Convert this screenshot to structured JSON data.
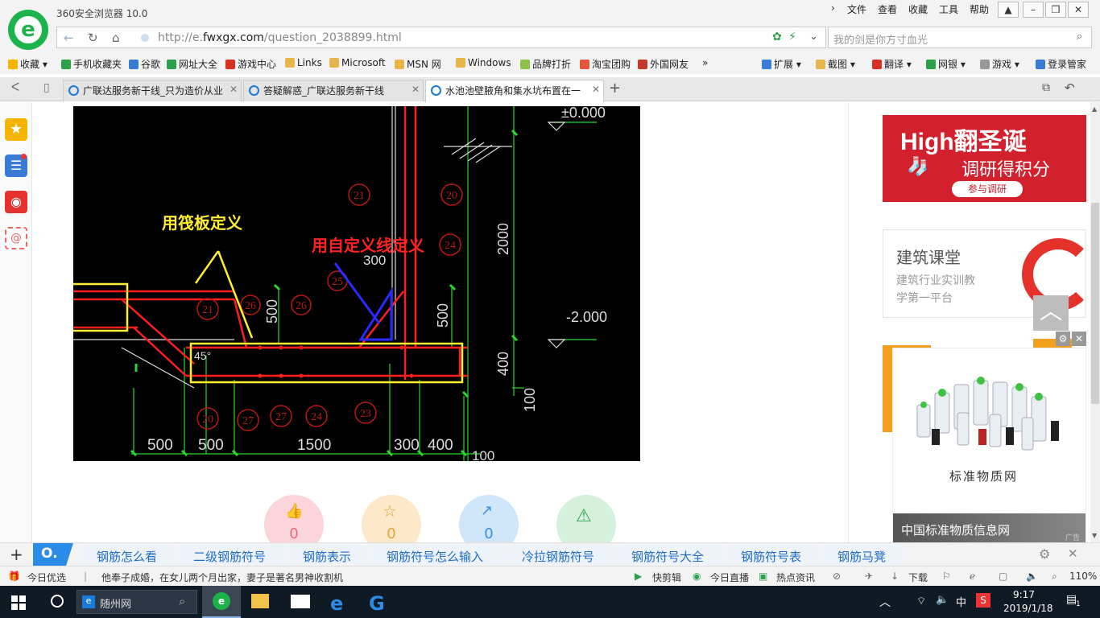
{
  "browser": {
    "app_title": "360安全浏览器 10.0",
    "menus": [
      "文件",
      "查看",
      "收藏",
      "工具",
      "帮助"
    ],
    "url_prefix": "http://e.",
    "url_domain": "fwxgx.com",
    "url_path": "/question_2038899.html",
    "search_placeholder": "我的剑是你方寸血光"
  },
  "bookmarks": {
    "left": [
      {
        "label": "收藏",
        "color": "#f5b400"
      },
      {
        "label": "手机收藏夹",
        "color": "#2aa14a"
      },
      {
        "label": "谷歌",
        "color": "#3a7bd5"
      },
      {
        "label": "网址大全",
        "color": "#2aa14a"
      },
      {
        "label": "游戏中心",
        "color": "#d93025"
      },
      {
        "label": "Links",
        "color": "#e8b54a"
      },
      {
        "label": "Microsoft",
        "color": "#e8b54a"
      },
      {
        "label": "MSN 网",
        "color": "#e8b54a"
      },
      {
        "label": "Windows",
        "color": "#e8b54a"
      },
      {
        "label": "品牌打折",
        "color": "#8bc34a"
      },
      {
        "label": "淘宝团购",
        "color": "#e8553a"
      },
      {
        "label": "外国网友",
        "color": "#c0392b"
      }
    ],
    "right": [
      {
        "label": "扩展",
        "color": "#3a7bd5"
      },
      {
        "label": "截图",
        "color": "#e8b54a"
      },
      {
        "label": "翻译",
        "color": "#d93025"
      },
      {
        "label": "网银",
        "color": "#2aa14a"
      },
      {
        "label": "游戏",
        "color": "#999999"
      },
      {
        "label": "登录管家",
        "color": "#3a7bd5"
      }
    ]
  },
  "tabs": [
    {
      "label": "广联达服务新干线_只为造价从业"
    },
    {
      "label": "答疑解惑_广联达服务新干线"
    },
    {
      "label": "水池池壁腋角和集水坑布置在一"
    }
  ],
  "cad": {
    "label_raft": "用筏板定义",
    "label_custom": "用自定义线定义",
    "elev_top": "±0.000",
    "elev_mid": "-2.000",
    "dim_2000": "2000",
    "dim_300_top": "300",
    "dim_500_a": "500",
    "dim_500_b": "500",
    "dim_400": "400",
    "dim_100_v": "100",
    "dim_100_h": "100",
    "angle": "45°",
    "bottom_dims": [
      "500",
      "500",
      "1500",
      "300",
      "400"
    ],
    "circles": [
      "21",
      "20",
      "24",
      "25",
      "21",
      "26",
      "26",
      "20",
      "27",
      "27",
      "24",
      "23"
    ]
  },
  "actions": [
    {
      "icon": "thumbs-up",
      "count": "0",
      "color": "#fbd5da",
      "fg": "#e66a7c"
    },
    {
      "icon": "star",
      "count": "0",
      "color": "#fde9c9",
      "fg": "#e6a23c"
    },
    {
      "icon": "share",
      "count": "0",
      "color": "#cfe6fb",
      "fg": "#3a8ee6"
    },
    {
      "icon": "warning",
      "count": "",
      "color": "#d5f1dc",
      "fg": "#2ea44f"
    }
  ],
  "ads": {
    "ad1_main": "High翻圣诞",
    "ad1_sub": "调研得积分",
    "ad1_btn": "参与调研",
    "ad2_title": "建筑课堂",
    "ad2_line1": "建筑行业实训教",
    "ad2_line2": "学第一平台",
    "ad3_caption": "标准物质网",
    "ad3_title": "中国标准物质信息网",
    "ad3_tag": "广告"
  },
  "hot_searches": [
    "钢筋怎么看",
    "二级钢筋符号",
    "钢筋表示",
    "钢筋符号怎么输入",
    "冷拉钢筋符号",
    "钢筋符号大全",
    "钢筋符号表",
    "钢筋马凳"
  ],
  "status": {
    "today": "今日优选",
    "news": "他奉子成婚，在女儿两个月出家，妻子是著名男神收割机",
    "items": [
      "快剪辑",
      "今日直播",
      "热点资讯",
      "下载"
    ],
    "zoom": "110%"
  },
  "taskbar": {
    "search_text": "随州网",
    "ime": "中",
    "time": "9:17",
    "date": "2019/1/18",
    "notif": "1"
  }
}
